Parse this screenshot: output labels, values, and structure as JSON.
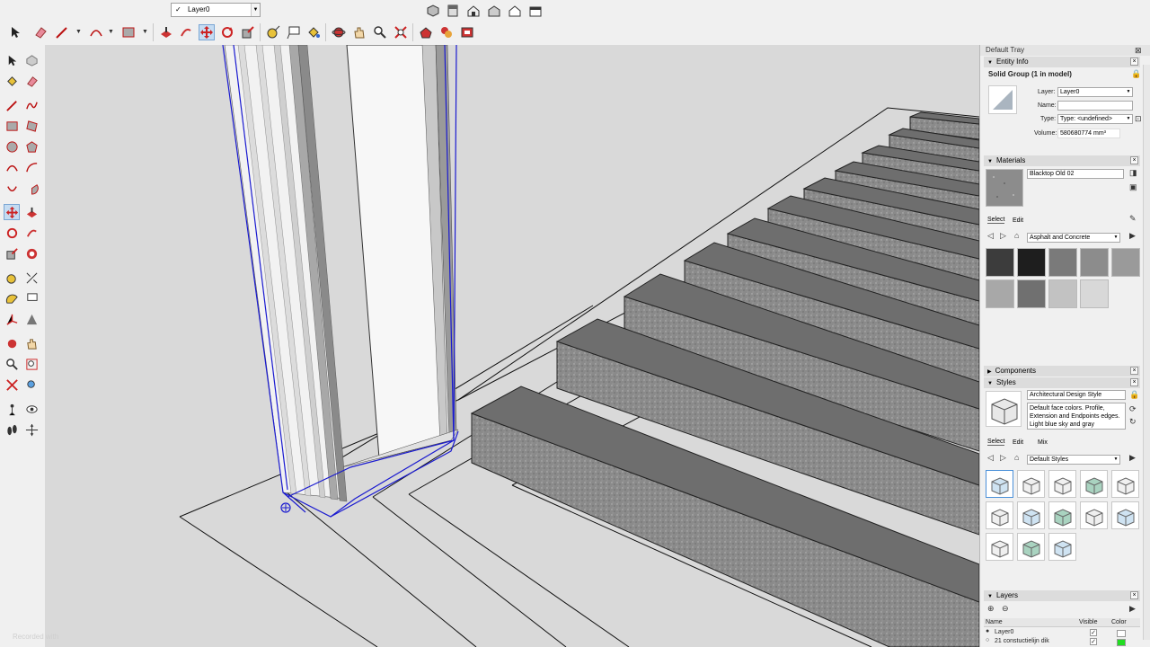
{
  "toolbar": {
    "layer_value": "Layer0",
    "layer_check": "✓"
  },
  "tray": {
    "title": "Default Tray",
    "entity_info": {
      "header": "Entity Info",
      "entity_title": "Solid Group (1 in model)",
      "layer_label": "Layer:",
      "layer_value": "Layer0",
      "name_label": "Name:",
      "name_value": "",
      "type_label": "Type:",
      "type_value": "Type: <undefined>",
      "volume_label": "Volume:",
      "volume_value": "580680774 mm³"
    },
    "materials": {
      "header": "Materials",
      "material_name": "Blacktop Old 02",
      "tab_select": "Select",
      "tab_edit": "Edit",
      "library": "Asphalt and Concrete",
      "swatch_colors": [
        "#3c3c3c",
        "#1e1e1e",
        "#7a7a7a",
        "#8c8c8c",
        "#9a9a9a",
        "#a8a8a8",
        "#707070",
        "#c2c2c2",
        "#d8d8d8"
      ]
    },
    "components": {
      "header": "Components"
    },
    "styles": {
      "header": "Styles",
      "style_name": "Architectural Design Style",
      "style_desc": "Default face colors. Profile, Extension and Endpoints edges. Light blue sky and gray",
      "tab_select": "Select",
      "tab_edit": "Edit",
      "tab_mix": "Mix",
      "library": "Default Styles"
    },
    "layers": {
      "header": "Layers",
      "col_name": "Name",
      "col_visible": "Visible",
      "col_color": "Color",
      "rows": [
        {
          "name": "Layer0",
          "visible": "✓",
          "color": "#ffffff"
        },
        {
          "name": "21 constuctielijn dik",
          "visible": "✓",
          "color": "#22dd22"
        }
      ]
    }
  },
  "watermark": "Recorded with"
}
